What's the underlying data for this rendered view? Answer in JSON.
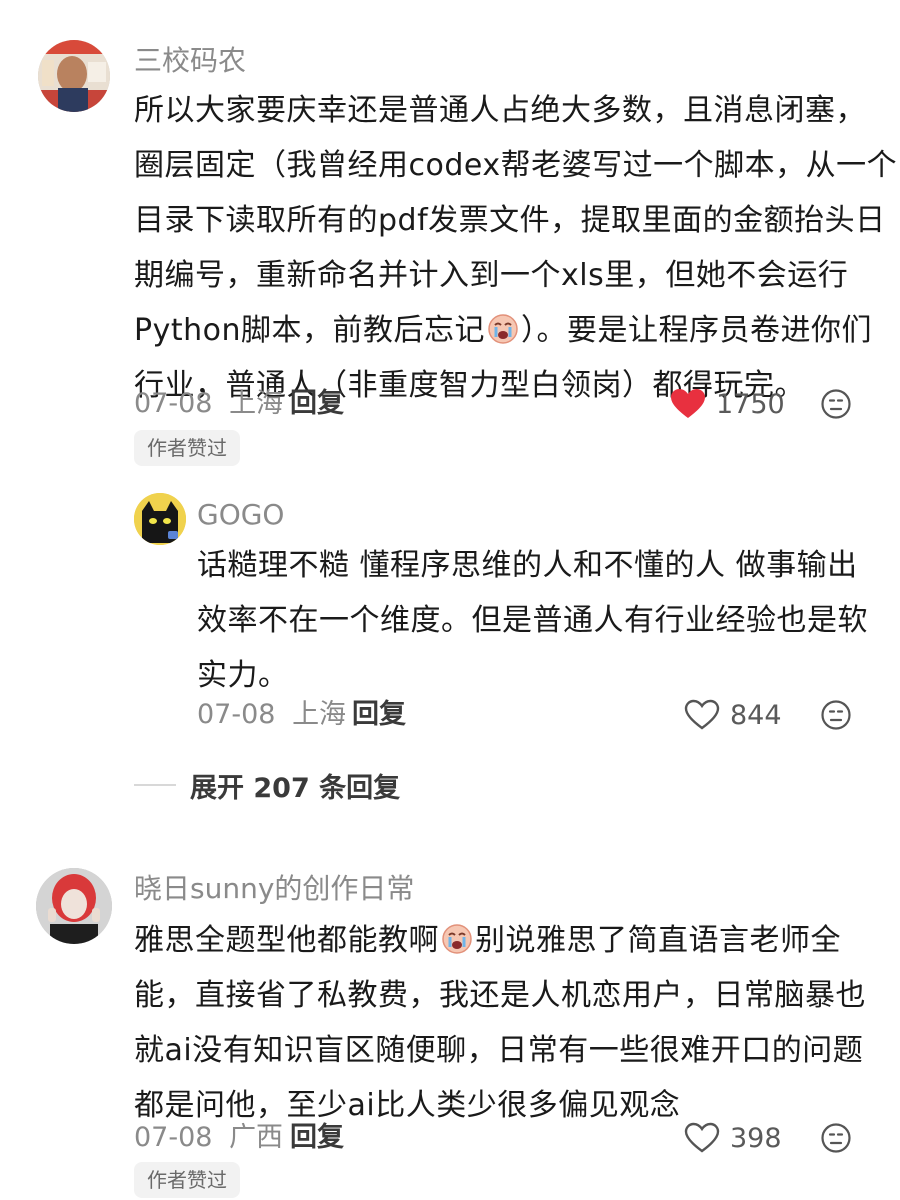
{
  "comments": [
    {
      "username": "三校码农",
      "lines": [
        "所以大家要庆幸还是普通人占绝大多数，且消息闭塞，",
        "圈层固定（我曾经用codex帮老婆写过一个脚本，从一个",
        "目录下读取所有的pdf发票文件，提取里面的金额抬头日",
        "期编号，重新命名并计入到一个xls里，但她不会运行",
        "Python脚本，前教后忘记",
        "）。要是让程序员卷进你们",
        "行业，普通人（非重度智力型白领岗）都得玩完。"
      ],
      "date": "07-08",
      "location": "上海",
      "reply_label": "回复",
      "likes": "1750",
      "liked": true,
      "badge": "作者赞过",
      "emoji": "crying-emoji"
    },
    {
      "username": "GOGO",
      "lines": [
        "话糙理不糙 懂程序思维的人和不懂的人 做事输出",
        "效率不在一个维度。但是普通人有行业经验也是软",
        "实力。"
      ],
      "date": "07-08",
      "location": "上海",
      "reply_label": "回复",
      "likes": "844",
      "liked": false
    },
    {
      "username": "晓日sunny的创作日常",
      "lines": [
        "雅思全题型他都能教啊",
        "别说雅思了简直语言老师全",
        "能，直接省了私教费，我还是人机恋用户，日常脑暴也",
        "就ai没有知识盲区随便聊，日常有一些很难开口的问题",
        "都是问他，至少ai比人类少很多偏见观念"
      ],
      "date": "07-08",
      "location": "广西",
      "reply_label": "回复",
      "likes": "398",
      "liked": false,
      "badge": "作者赞过",
      "emoji": "crying-emoji"
    }
  ],
  "expand_replies": "展开 207 条回复",
  "colors": {
    "heart_active": "#e8303f",
    "meta_gray": "#8a8a8a",
    "badge_bg": "#f2f2f2"
  }
}
